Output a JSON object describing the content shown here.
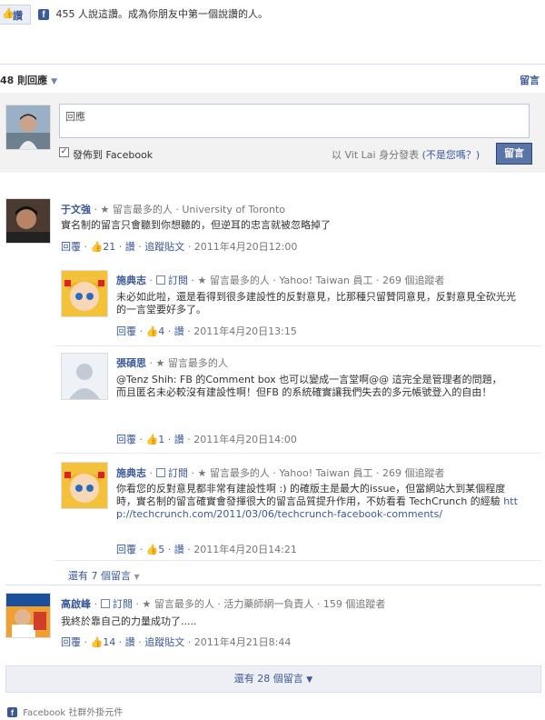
{
  "like_bar": {
    "like_label": "讚",
    "social_text": "455 人說這讚。成為你朋友中第一個說讚的人。"
  },
  "header": {
    "count_label": "48 則回應",
    "post_link": "留言"
  },
  "composer": {
    "placeholder": "回應",
    "publish_label": "發佈到 Facebook",
    "post_as": "以 Vit Lai 身分發表",
    "not_you": "(不是您嗎？)",
    "post_button": "留言"
  },
  "comments": [
    {
      "name": "于文強",
      "meta": "· ★ 留言最多的人 · University of Toronto",
      "text": "實名制的留言只會聽到你想聽的，但逆耳的忠言就被忽略掉了",
      "reply": "回覆",
      "likes": "21",
      "like": "讚",
      "follow": "追蹤貼文",
      "time": "· 2011年4月20日12:00"
    },
    {
      "name": "施典志",
      "subscribe": "訂閱",
      "meta": "· ★ 留言最多的人 · Yahoo! Taiwan 員工 · 269 個追蹤者",
      "text": "未必如此啦，還是看得到很多建設性的反對意見，比那種只留贊同意見，反對意見全砍光光的一言堂要好多了。",
      "reply": "回覆",
      "likes": "4",
      "like": "讚",
      "time": "· 2011年4月20日13:15"
    },
    {
      "name": "張碩思",
      "meta": "· ★ 留言最多的人",
      "text_line1": "@Tenz Shih: FB 的Comment box 也可以變成一言堂啊@@ 這完全是管理者的問題，",
      "text_line2": "而且匿名未必較沒有建設性啊！但FB 的系統確實讓我們失去的多元帳號登入的自由！",
      "reply": "回覆",
      "likes": "1",
      "like": "讚",
      "time": "· 2011年4月20日14:00"
    },
    {
      "name": "施典志",
      "subscribe": "訂閱",
      "meta": "· ★ 留言最多的人 · Yahoo! Taiwan 員工 · 269 個追蹤者",
      "text": "你看您的反對意見都非常有建設性啊 :) 的確版主是最大的issue，但當網站大到某個程度時，實名制的留言確實會發揮很大的留言品質提升作用，不妨看看 TechCrunch 的經驗",
      "url": "http://techcrunch.com/2011/03/06/techcrunch-facebook-comments/",
      "reply": "回覆",
      "likes": "5",
      "like": "讚",
      "time": "· 2011年4月20日14:21"
    },
    {
      "name": "高啟峰",
      "subscribe": "訂閱",
      "meta": "· ★ 留言最多的人 · 活力藥師網一負責人 · 159 個追蹤者",
      "text": "我終於靠自己的力量成功了.....",
      "reply": "回覆",
      "likes": "14",
      "like": "讚",
      "follow": "追蹤貼文",
      "time": "· 2011年4月21日8:44"
    }
  ],
  "more_replies": "還有 7 個留言",
  "more_comments": "還有 28 個留言",
  "footer": "Facebook 社群外掛元件",
  "colors": {
    "link": "#3b5998",
    "composer_bg": "#f2f2f2",
    "button": "#5b74a8",
    "more_bar": "#edeff4"
  }
}
